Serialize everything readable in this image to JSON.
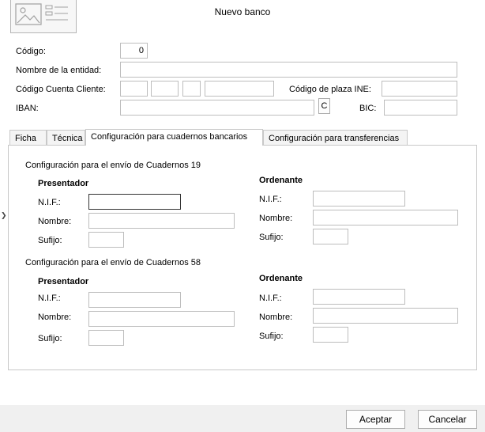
{
  "window": {
    "title": "Nuevo banco"
  },
  "form": {
    "codigo_label": "Código:",
    "codigo_value": "0",
    "nombre_label": "Nombre de la entidad:",
    "ccc_label": "Código Cuenta Cliente:",
    "plaza_label": "Código de plaza INE:",
    "iban_label": "IBAN:",
    "iban_button": "C",
    "bic_label": "BIC:"
  },
  "tabs": [
    {
      "label": "Ficha"
    },
    {
      "label": "Técnica"
    },
    {
      "label": "Configuración para cuadernos bancarios"
    },
    {
      "label": "Configuración para transferencias"
    }
  ],
  "cuadernos": {
    "c19": {
      "heading": "Configuración para el envío de Cuadernos 19",
      "presentador": {
        "title": "Presentador",
        "nif_label": "N.I.F.:",
        "nombre_label": "Nombre:",
        "sufijo_label": "Sufijo:"
      },
      "ordenante": {
        "title": "Ordenante",
        "nif_label": "N.I.F.:",
        "nombre_label": "Nombre:",
        "sufijo_label": "Sufijo:"
      }
    },
    "c58": {
      "heading": "Configuración para el envío de Cuadernos 58",
      "presentador": {
        "title": "Presentador",
        "nif_label": "N.I.F.:",
        "nombre_label": "Nombre:",
        "sufijo_label": "Sufijo:"
      },
      "ordenante": {
        "title": "Ordenante",
        "nif_label": "N.I.F.:",
        "nombre_label": "Nombre:",
        "sufijo_label": "Sufijo:"
      }
    }
  },
  "footer": {
    "accept_label": "Aceptar",
    "cancel_label": "Cancelar"
  },
  "icons": {
    "logo": "image-placeholder-icon",
    "side_arrow": "chevron-right-icon"
  }
}
